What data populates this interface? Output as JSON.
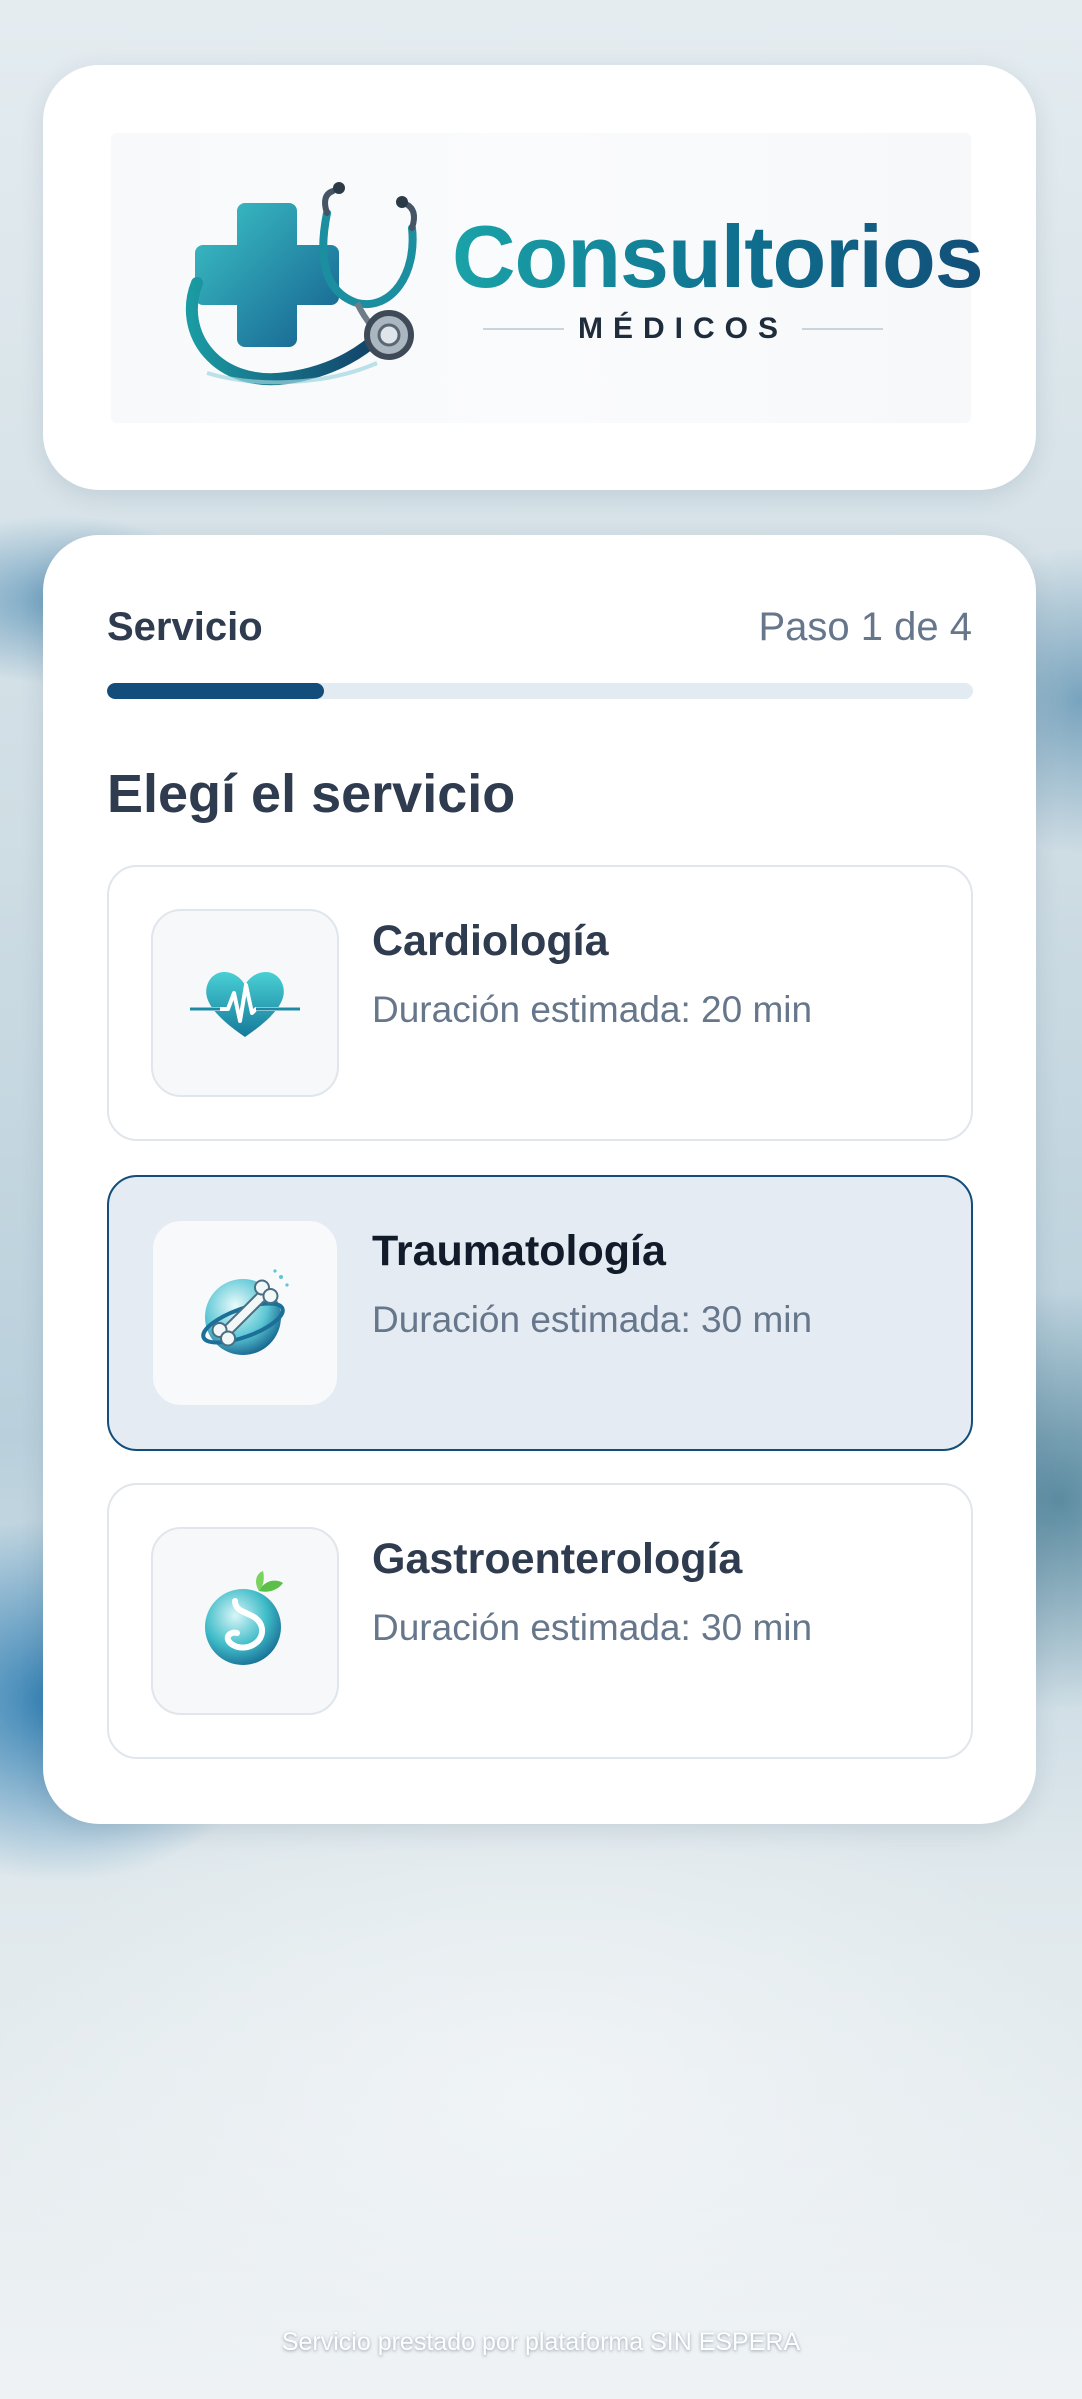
{
  "brand": {
    "name": "Consultorios",
    "subtitle": "MÉDICOS"
  },
  "stepper": {
    "label": "Servicio",
    "count": "Paso 1 de 4",
    "progress_fraction": 0.25
  },
  "section": {
    "title": "Elegí el servicio"
  },
  "services": [
    {
      "name": "Cardiología",
      "duration": "Duración estimada: 20 min",
      "icon": "heart-pulse-icon",
      "selected": false
    },
    {
      "name": "Traumatología",
      "duration": "Duración estimada: 30 min",
      "icon": "bone-icon",
      "selected": true
    },
    {
      "name": "Gastroenterología",
      "duration": "Duración estimada: 30 min",
      "icon": "stomach-icon",
      "selected": false
    }
  ],
  "footer": {
    "text": "Servicio prestado por plataforma SIN ESPERA"
  },
  "colors": {
    "accent": "#124d7c",
    "brand_teal": "#1aa3a8",
    "selected_bg": "#e4ebf2"
  }
}
